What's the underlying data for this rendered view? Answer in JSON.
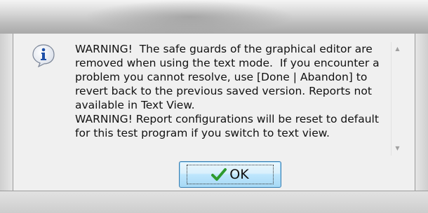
{
  "dialog": {
    "message": "WARNING!  The safe guards of the graphical editor are removed when using the text mode.  If you encounter a problem you cannot resolve, use [Done | Abandon] to revert back to the previous saved version. Reports not available in Text View.\nWARNING! Report configurations will be reset to default for this test program if you switch to text view.",
    "icon": "info-icon",
    "ok_label": "OK",
    "ok_icon": "checkmark-icon"
  },
  "colors": {
    "icon_blue": "#1d4fa8",
    "check_green": "#2e9a2e",
    "button_border": "#3c7fb1"
  }
}
